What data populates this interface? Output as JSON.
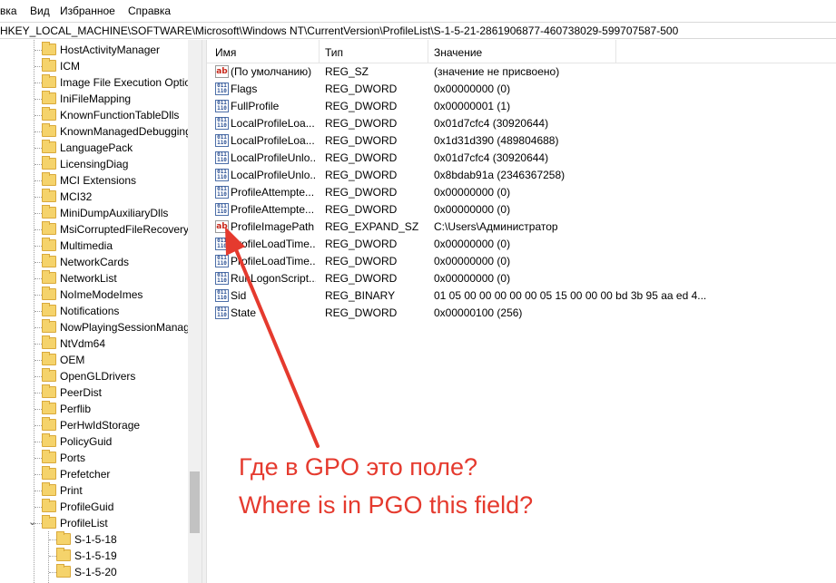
{
  "menu": [
    "вка",
    "Вид",
    "Избранное",
    "Справка"
  ],
  "address": "HKEY_LOCAL_MACHINE\\SOFTWARE\\Microsoft\\Windows NT\\CurrentVersion\\ProfileList\\S-1-5-21-2861906877-460738029-599707587-500",
  "tree": {
    "items": [
      "HostActivityManager",
      "ICM",
      "Image File Execution Optio",
      "IniFileMapping",
      "KnownFunctionTableDlls",
      "KnownManagedDebugging",
      "LanguagePack",
      "LicensingDiag",
      "MCI Extensions",
      "MCI32",
      "MiniDumpAuxiliaryDlls",
      "MsiCorruptedFileRecovery",
      "Multimedia",
      "NetworkCards",
      "NetworkList",
      "NoImeModeImes",
      "Notifications",
      "NowPlayingSessionManag",
      "NtVdm64",
      "OEM",
      "OpenGLDrivers",
      "PeerDist",
      "Perflib",
      "PerHwIdStorage",
      "PolicyGuid",
      "Ports",
      "Prefetcher",
      "Print",
      "ProfileGuid",
      "ProfileList"
    ],
    "expanded_chevron": "⌄",
    "children": [
      "S-1-5-18",
      "S-1-5-19",
      "S-1-5-20"
    ]
  },
  "columns": {
    "name": "Имя",
    "type": "Тип",
    "data": "Значение"
  },
  "values": [
    {
      "icon": "string",
      "name": "(По умолчанию)",
      "type": "REG_SZ",
      "data": "(значение не присвоено)"
    },
    {
      "icon": "binary",
      "name": "Flags",
      "type": "REG_DWORD",
      "data": "0x00000000 (0)"
    },
    {
      "icon": "binary",
      "name": "FullProfile",
      "type": "REG_DWORD",
      "data": "0x00000001 (1)"
    },
    {
      "icon": "binary",
      "name": "LocalProfileLoa...",
      "type": "REG_DWORD",
      "data": "0x01d7cfc4 (30920644)"
    },
    {
      "icon": "binary",
      "name": "LocalProfileLoa...",
      "type": "REG_DWORD",
      "data": "0x1d31d390 (489804688)"
    },
    {
      "icon": "binary",
      "name": "LocalProfileUnlo...",
      "type": "REG_DWORD",
      "data": "0x01d7cfc4 (30920644)"
    },
    {
      "icon": "binary",
      "name": "LocalProfileUnlo...",
      "type": "REG_DWORD",
      "data": "0x8bdab91a (2346367258)"
    },
    {
      "icon": "binary",
      "name": "ProfileAttempte...",
      "type": "REG_DWORD",
      "data": "0x00000000 (0)"
    },
    {
      "icon": "binary",
      "name": "ProfileAttempte...",
      "type": "REG_DWORD",
      "data": "0x00000000 (0)"
    },
    {
      "icon": "string",
      "name": "ProfileImagePath",
      "type": "REG_EXPAND_SZ",
      "data": "C:\\Users\\Администратор"
    },
    {
      "icon": "binary",
      "name": "ProfileLoadTime...",
      "type": "REG_DWORD",
      "data": "0x00000000 (0)"
    },
    {
      "icon": "binary",
      "name": "ProfileLoadTime...",
      "type": "REG_DWORD",
      "data": "0x00000000 (0)"
    },
    {
      "icon": "binary",
      "name": "RunLogonScript...",
      "type": "REG_DWORD",
      "data": "0x00000000 (0)"
    },
    {
      "icon": "binary",
      "name": "Sid",
      "type": "REG_BINARY",
      "data": "01 05 00 00 00 00 00 05 15 00 00 00 bd 3b 95 aa ed 4..."
    },
    {
      "icon": "binary",
      "name": "State",
      "type": "REG_DWORD",
      "data": "0x00000100 (256)"
    }
  ],
  "icon_glyphs": {
    "string": "ab",
    "binary": "011 110"
  },
  "annotation": {
    "line1": "Где в GPO это поле?",
    "line2": "Where is in PGO this field?",
    "color": "#e53a2e"
  }
}
